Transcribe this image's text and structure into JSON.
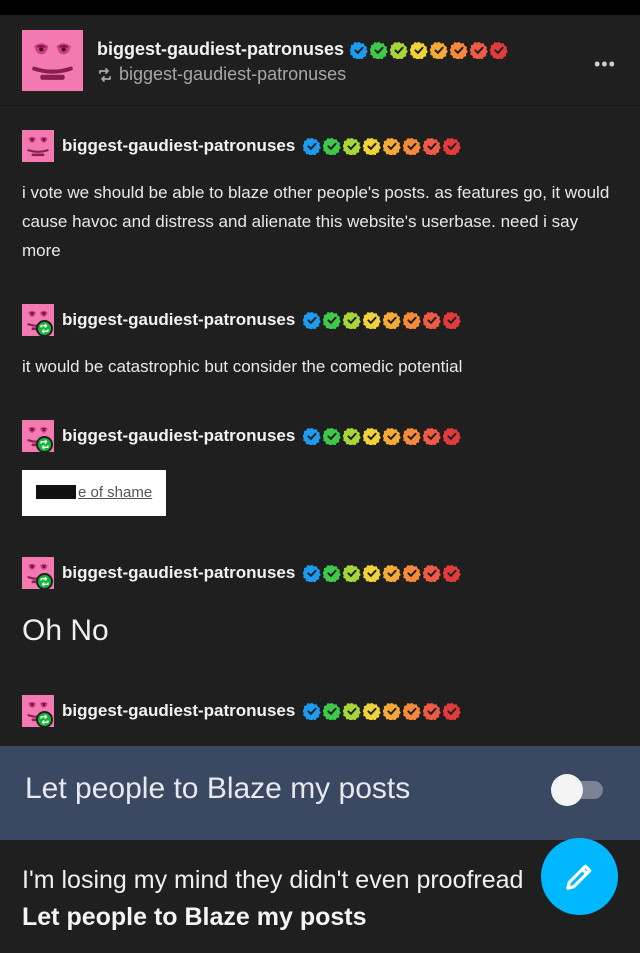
{
  "header": {
    "username": "biggest-gaudiest-patronuses",
    "reblogged_from": "biggest-gaudiest-patronuses",
    "more_icon": "more-horizontal-icon"
  },
  "badge_colors": [
    "#1d9bf0",
    "#3ec94a",
    "#a7d63a",
    "#f0d23a",
    "#f7a935",
    "#f58a3c",
    "#ee5a45",
    "#e23b3b"
  ],
  "entries": [
    {
      "username": "biggest-gaudiest-patronuses",
      "reblog": false,
      "text": "i vote we should be able to blaze other people's posts. as features go, it would cause havoc and distress and alienate this website's userbase. need i say more"
    },
    {
      "username": "biggest-gaudiest-patronuses",
      "reblog": true,
      "text": "it would be catastrophic but consider the comedic potential"
    },
    {
      "username": "biggest-gaudiest-patronuses",
      "reblog": true,
      "image_text": "e of shame"
    },
    {
      "username": "biggest-gaudiest-patronuses",
      "reblog": true,
      "text": "Oh No"
    },
    {
      "username": "biggest-gaudiest-patronuses",
      "reblog": true
    }
  ],
  "blaze_setting": {
    "label": "Let people to Blaze my posts",
    "enabled": false
  },
  "footer_text": {
    "line1": "I'm losing my mind they didn't even proofread",
    "line2": "Let people to Blaze my posts"
  },
  "fab": {
    "icon": "pencil-icon",
    "color": "#00b8ff"
  },
  "colors": {
    "background": "#1f1f1f",
    "setting_bar": "#3a4862",
    "avatar": "#f27ab0",
    "reblog_badge": "#16b63c"
  }
}
